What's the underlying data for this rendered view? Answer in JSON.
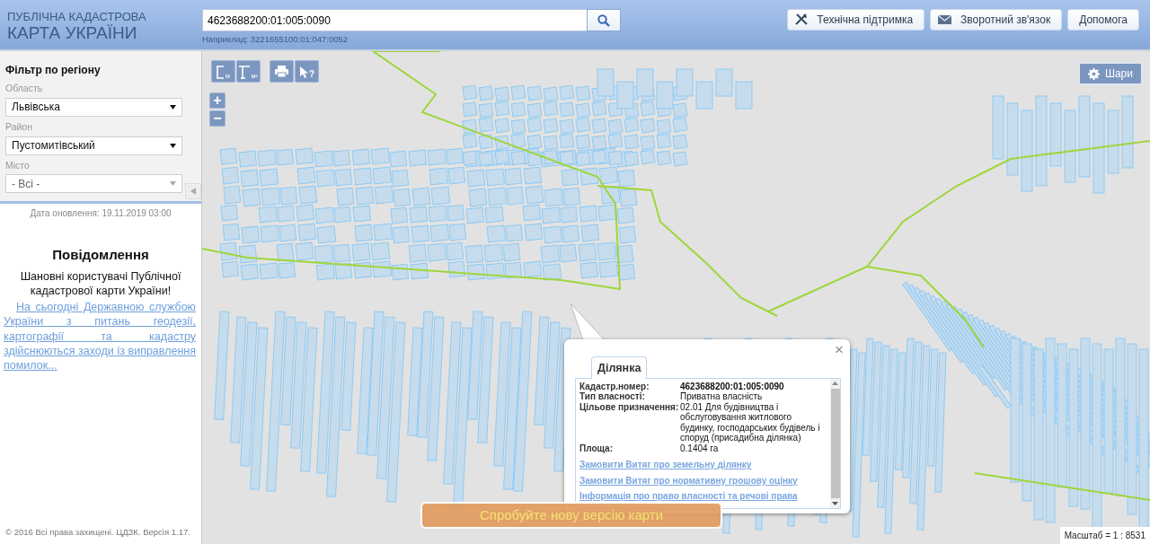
{
  "header": {
    "title_line1": "ПУБЛІЧНА КАДАСТРОВА",
    "title_line2": "КАРТА УКРАЇНИ",
    "search": {
      "value": "4623688200:01:005:0090",
      "hint": "Наприклад: 3221655100:01:047:0052"
    },
    "buttons": [
      {
        "kind": "tools",
        "label": "Технічна підтримка"
      },
      {
        "kind": "mail",
        "label": "Зворотний зв'язок"
      },
      {
        "kind": "plain",
        "label": "Допомога"
      }
    ]
  },
  "sidebar": {
    "filter_title": "Фільтр по регіону",
    "filters": [
      {
        "label": "Область",
        "value": "Львівська",
        "disabled": false
      },
      {
        "label": "Район",
        "value": "Пустомитівський",
        "disabled": false
      },
      {
        "label": "Місто",
        "value": "- Всі -",
        "disabled": true
      }
    ],
    "update_date": "Дата оновлення: 19.11.2019 03:00",
    "notice": {
      "title": "Повідомлення",
      "greeting": "Шановні користувачі Публічної кадастрової карти України!",
      "link": "На сьогодні Державною службою України з питань геодезії, картографії та кадастру здійснюються заходи із виправлення помилок..."
    },
    "footer": "© 2016 Всі права захищені. ЦДЗК. Версія 1.17."
  },
  "map": {
    "tools": [
      {
        "kind": "ruler",
        "label": "м"
      },
      {
        "kind": "area",
        "label": "м²"
      },
      {
        "kind": "print"
      },
      {
        "kind": "identify",
        "label": "?"
      }
    ],
    "zoom": [
      "+",
      "−"
    ],
    "layers_button": "Шари",
    "popup": {
      "close": "×",
      "tabs": [
        {
          "label": "Ділянка",
          "selected": true
        }
      ],
      "fields": [
        {
          "label": "Кадастр.номер:",
          "value": "4623688200:01:005:0090",
          "bold": true
        },
        {
          "label": "Тип власності:",
          "value": "Приватна власність",
          "bold": false
        },
        {
          "label": "Цільове призначення:",
          "value": "02.01 Для будівництва і обслуговування житлового будинку, господарських будівель і споруд (присадибна ділянка)",
          "bold": false
        },
        {
          "label": "Площа:",
          "value": "0.1404 га",
          "bold": false
        }
      ],
      "links": [
        "Замовити Витяг про земельну ділянку",
        "Замовити Витяг про нормативну грошову оцінку",
        "Інформація про право власності та речові права"
      ]
    },
    "new_version_button": "Спробуйте нову версію карти",
    "scale": "Масштаб = 1 : 8531"
  }
}
